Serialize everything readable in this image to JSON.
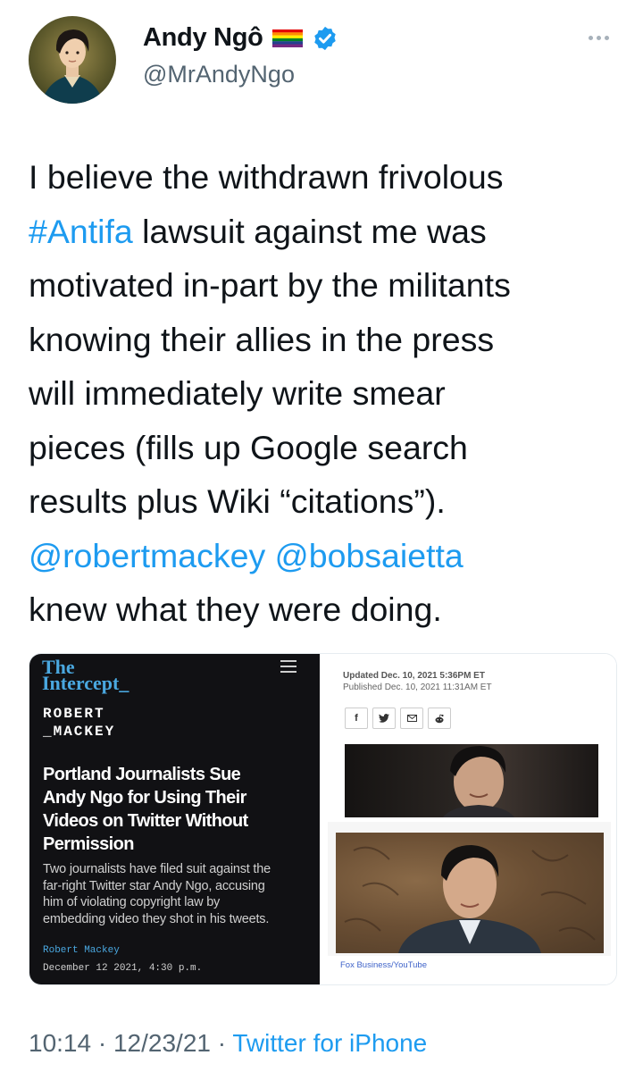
{
  "author": {
    "display_name": "Andy Ngô",
    "handle": "@MrAndyNgo",
    "badges": [
      "rainbow-flag-icon",
      "verified-badge-icon"
    ],
    "verified_color": "#1d9bf0"
  },
  "tweet": {
    "lines": [
      [
        {
          "text": "I believe the withdrawn frivolous"
        }
      ],
      [
        {
          "text": "#Antifa",
          "link": true
        },
        {
          "text": " lawsuit against me was"
        }
      ],
      [
        {
          "text": "motivated in-part by the militants"
        }
      ],
      [
        {
          "text": "knowing their allies in the press"
        }
      ],
      [
        {
          "text": "will immediately write smear"
        }
      ],
      [
        {
          "text": "pieces (fills up Google search"
        }
      ],
      [
        {
          "text": "results plus Wiki “citations”)."
        }
      ],
      [
        {
          "text": "@robertmackey",
          "link": true
        },
        {
          "text": " "
        },
        {
          "text": "@bobsaietta",
          "link": true
        }
      ],
      [
        {
          "text": "knew what they were doing."
        }
      ]
    ],
    "link_color": "#1d9bf0"
  },
  "media": {
    "left_article": {
      "logo_line1": "The",
      "logo_line2": "Intercept_",
      "author_tag_line1": "ROBERT",
      "author_tag_line2": "_MACKEY",
      "headline_lines": [
        "Portland Journalists Sue",
        "Andy Ngo for Using Their",
        "Videos on Twitter Without",
        "Permission"
      ],
      "dek_lines": [
        "Two journalists have filed suit against the",
        "far-right Twitter star Andy Ngo, accusing",
        "him of violating copyright law by",
        "embedding video they shot in his tweets."
      ],
      "byline": "Robert Mackey",
      "date": "December 12 2021, 4:30 p.m.",
      "accent_color": "#4aa8e0",
      "background": "#111114"
    },
    "right_article": {
      "updated": "Updated Dec. 10, 2021 5:36PM ET",
      "published": "Published Dec. 10, 2021 11:31AM ET",
      "share_icons": [
        {
          "name": "facebook-icon",
          "glyph": "f"
        },
        {
          "name": "twitter-icon",
          "glyph": "🐦"
        },
        {
          "name": "email-icon",
          "glyph": "✉"
        },
        {
          "name": "reddit-icon",
          "glyph": "👽"
        }
      ],
      "caption": "Fox Business/YouTube"
    }
  },
  "meta": {
    "time": "10:14",
    "date": "12/23/21",
    "separator": " · ",
    "source": "Twitter for iPhone"
  }
}
